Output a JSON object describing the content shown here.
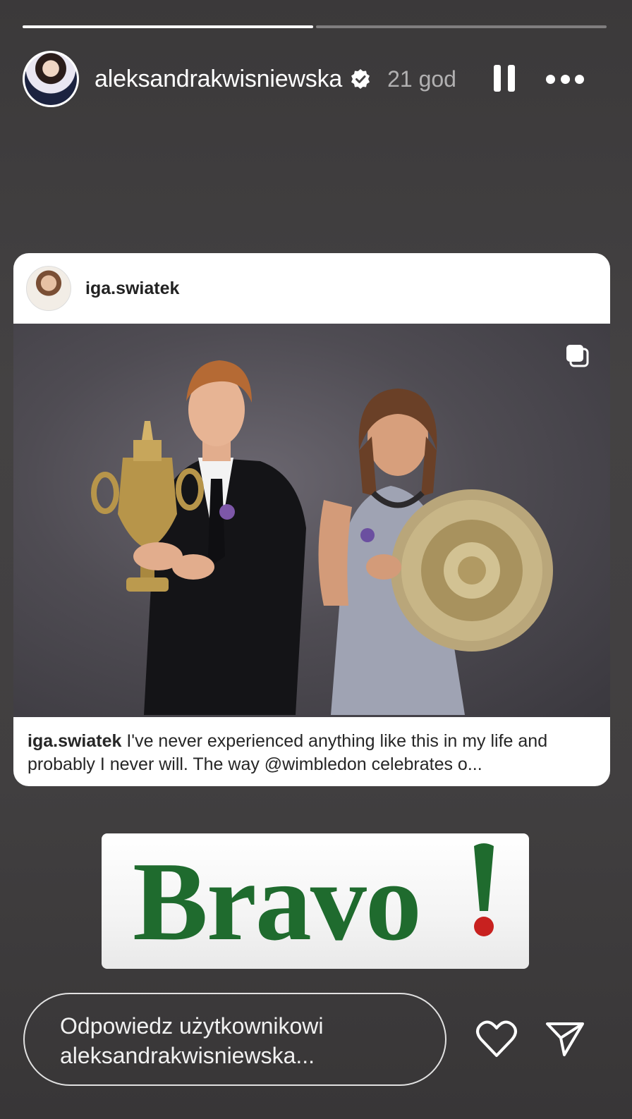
{
  "story": {
    "progress_segments": 2,
    "progress_done": 1
  },
  "header": {
    "username": "aleksandrakwisniewska",
    "time": "21 god",
    "verified_icon": "verified-badge-icon",
    "pause_icon": "pause-icon",
    "more_icon": "more-icon"
  },
  "shared_post": {
    "username": "iga.swiatek",
    "caption_user": "iga.swiatek",
    "caption_text": " I've never experienced anything like this in my life and probably I never will. The way @wimbledon celebrates o...",
    "multi_icon": "carousel-icon"
  },
  "sticker": {
    "text": "Bravo",
    "exclamation": "!"
  },
  "footer": {
    "reply_placeholder": "Odpowiedz użytkownikowi aleksandrakwisniewska...",
    "heart_icon": "heart-icon",
    "send_icon": "send-icon"
  },
  "colors": {
    "background": "#3f3d3e",
    "sticker_green": "#1f6b2e",
    "sticker_red": "#c8211f"
  }
}
